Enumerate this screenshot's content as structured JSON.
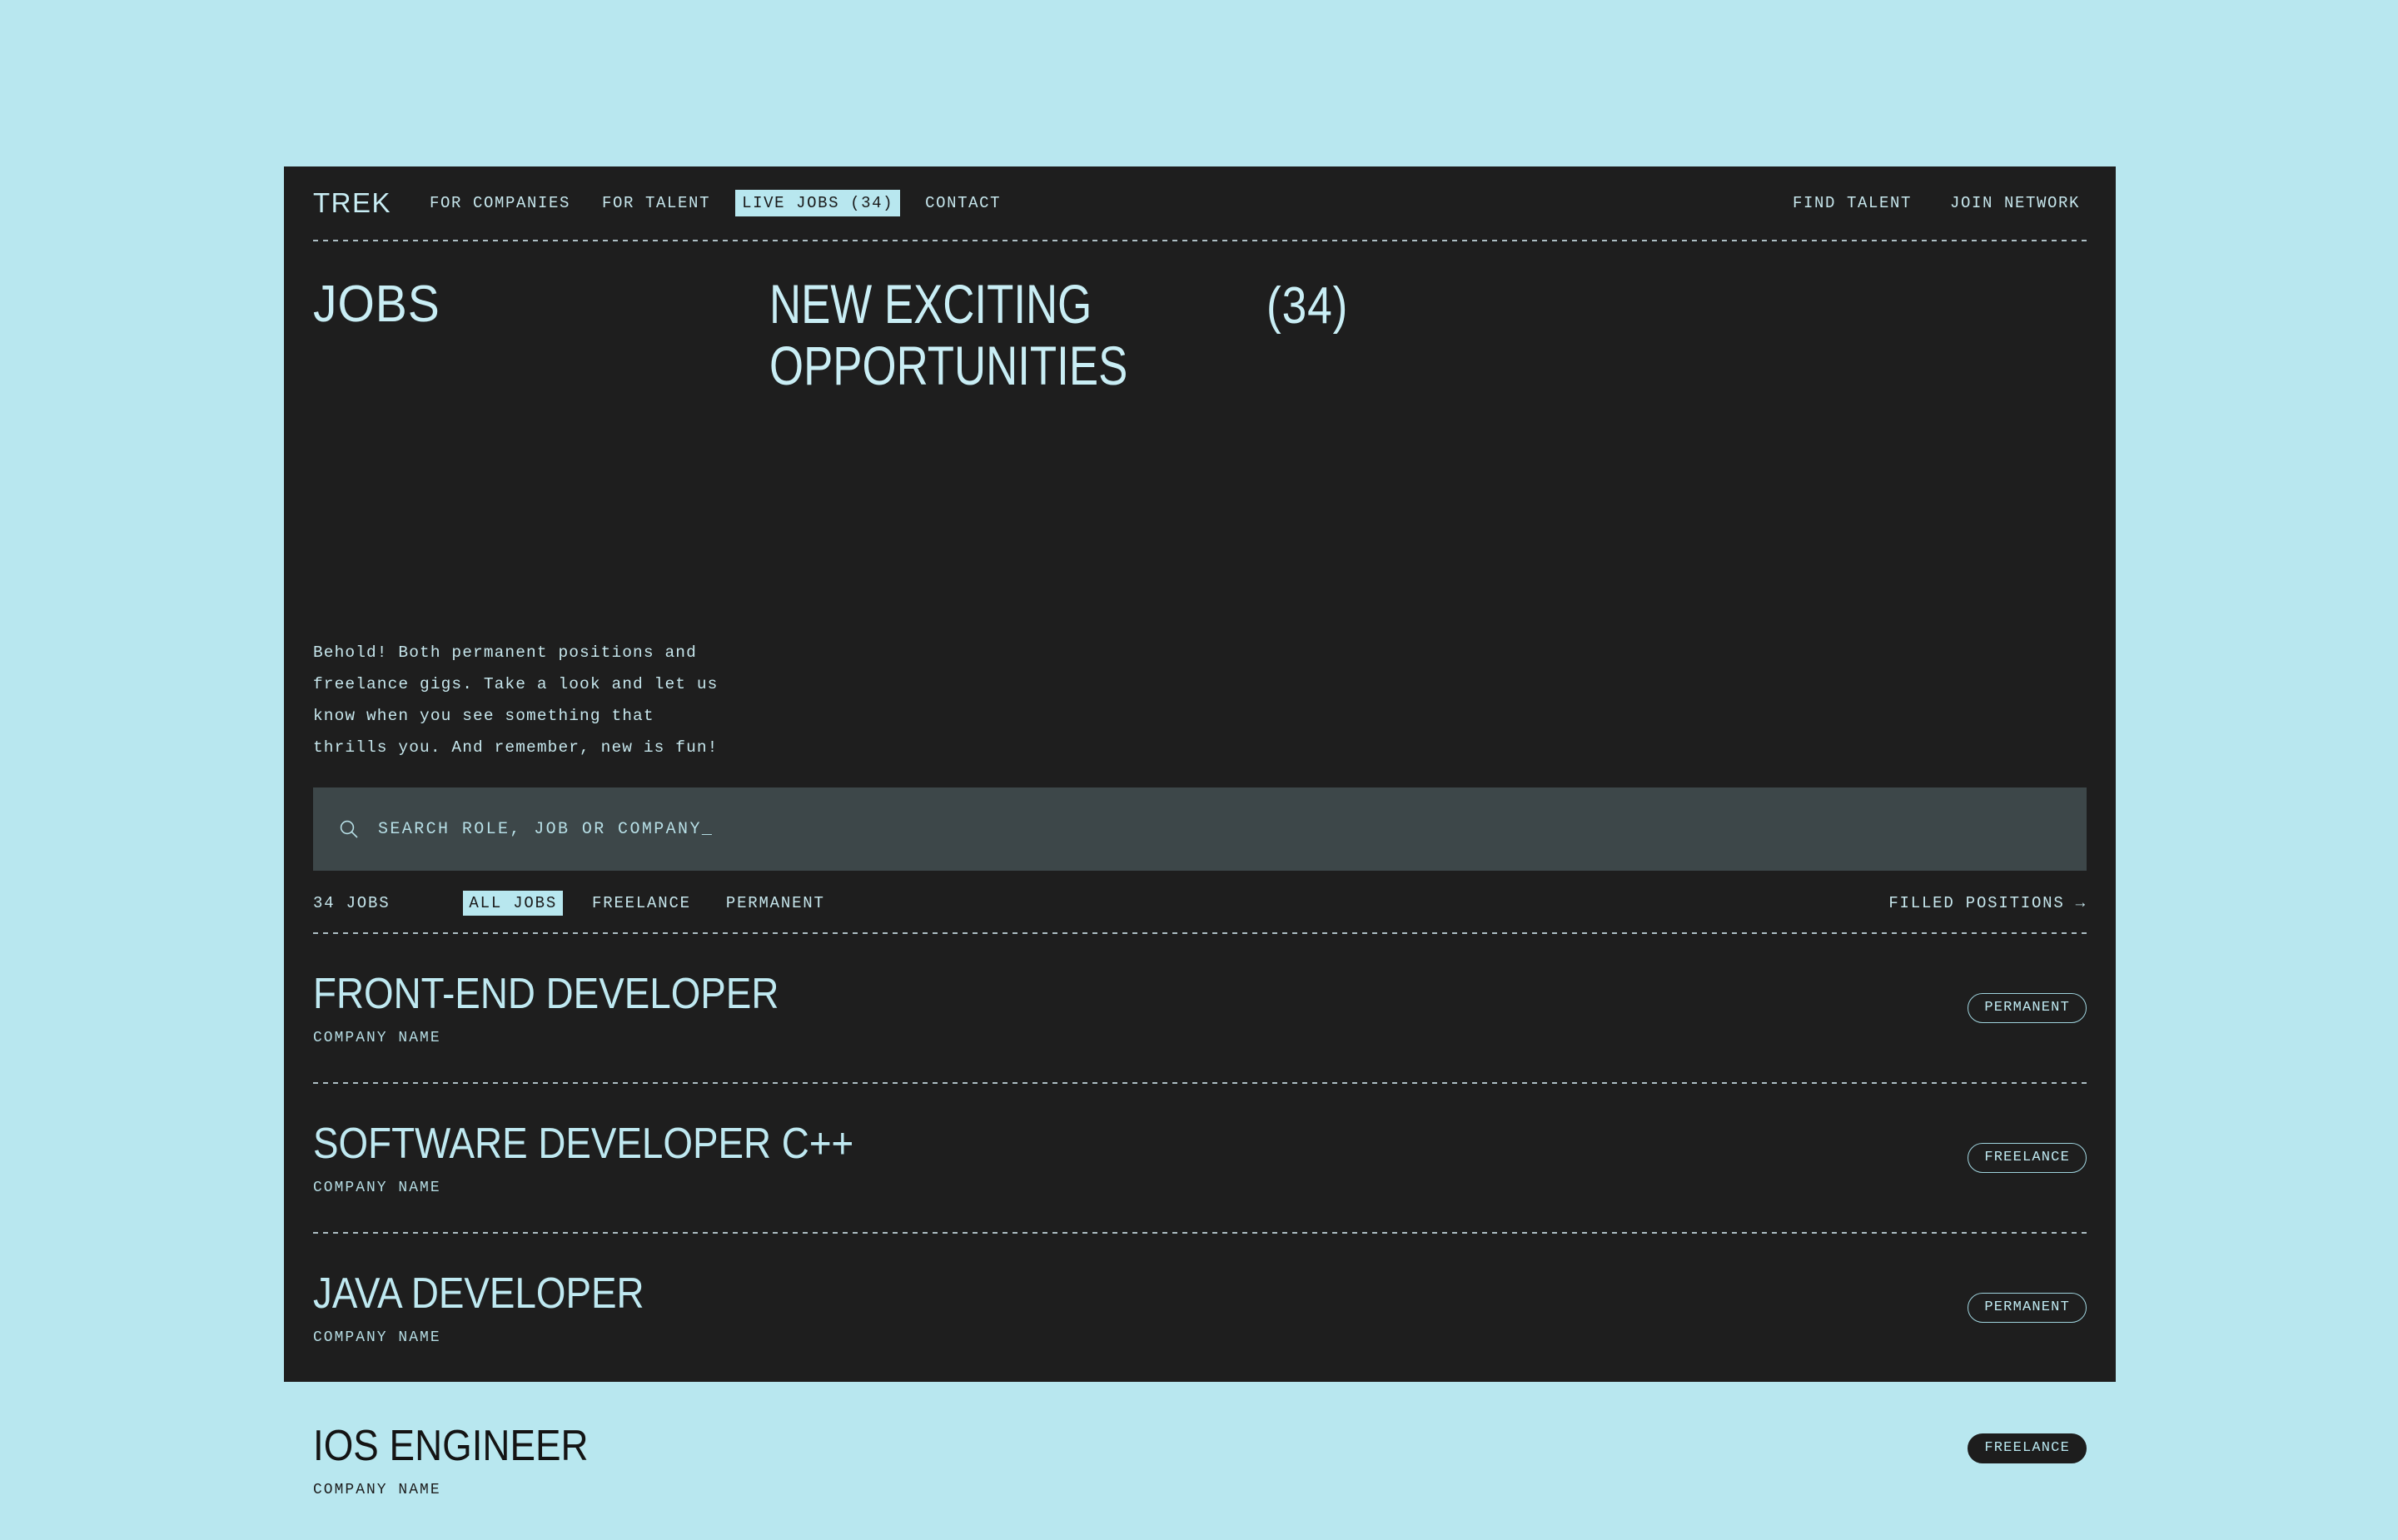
{
  "colors": {
    "page_bg": "#b8e7ef",
    "panel_bg": "#1e1e1e",
    "accent": "#b8e7ef",
    "search_bg": "#3d4749",
    "text": "#c6e6ec"
  },
  "header": {
    "logo": "TREK",
    "nav_left": [
      {
        "label": "FOR COMPANIES",
        "active": false
      },
      {
        "label": "FOR TALENT",
        "active": false
      },
      {
        "label": "LIVE JOBS (34)",
        "active": true
      },
      {
        "label": "CONTACT",
        "active": false
      }
    ],
    "nav_right": [
      {
        "label": "FIND TALENT"
      },
      {
        "label": "JOIN NETWORK"
      }
    ]
  },
  "hero": {
    "kicker": "JOBS",
    "title_line1": "NEW EXCITING",
    "title_line2": "OPPORTUNITIES",
    "count": "(34)"
  },
  "intro": {
    "line1": "Behold! Both permanent positions and",
    "line2": "freelance gigs. Take a look and let us",
    "line3": "know when you see something that",
    "line4": "thrills you. And remember, new is fun!"
  },
  "search": {
    "icon": "search-icon",
    "placeholder": "SEARCH ROLE, JOB OR COMPANY_",
    "value": ""
  },
  "filters": {
    "count_label": "34 JOBS",
    "tabs": [
      {
        "label": "ALL JOBS",
        "active": true
      },
      {
        "label": "FREELANCE",
        "active": false
      },
      {
        "label": "PERMANENT",
        "active": false
      }
    ],
    "filled_link": "FILLED POSITIONS →"
  },
  "jobs": [
    {
      "title": "FRONT-END DEVELOPER",
      "company": "COMPANY NAME",
      "type": "PERMANENT",
      "hot": false
    },
    {
      "title": "SOFTWARE DEVELOPER C++",
      "company": "COMPANY NAME",
      "type": "FREELANCE",
      "hot": false
    },
    {
      "title": "JAVA DEVELOPER",
      "company": "COMPANY NAME",
      "type": "PERMANENT",
      "hot": false
    },
    {
      "title": "IOS ENGINEER",
      "company": "COMPANY NAME",
      "type": "FREELANCE",
      "hot": true
    }
  ]
}
